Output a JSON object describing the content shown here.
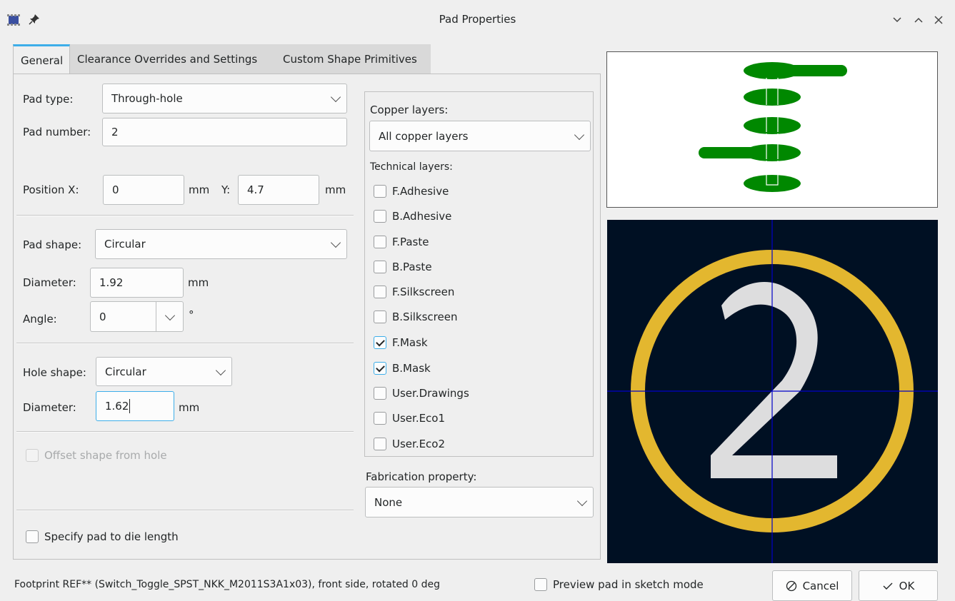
{
  "window": {
    "title": "Pad Properties",
    "icons": [
      "kicad-footprint-icon",
      "pin-icon"
    ],
    "controls": [
      "minimize-icon",
      "maximize-icon",
      "close-icon"
    ]
  },
  "tabs": [
    {
      "label": "General",
      "active": true
    },
    {
      "label": "Clearance Overrides and Settings",
      "active": false
    },
    {
      "label": "Custom Shape Primitives",
      "active": false
    }
  ],
  "general": {
    "pad_type_label": "Pad type:",
    "pad_type_value": "Through-hole",
    "pad_number_label": "Pad number:",
    "pad_number_value": "2",
    "position_x_label": "Position X:",
    "position_x_value": "0",
    "position_x_unit": "mm",
    "position_y_label": "Y:",
    "position_y_value": "4.7",
    "position_y_unit": "mm",
    "pad_shape_label": "Pad shape:",
    "pad_shape_value": "Circular",
    "diameter_label": "Diameter:",
    "diameter_value": "1.92",
    "diameter_unit": "mm",
    "angle_label": "Angle:",
    "angle_value": "0",
    "angle_unit": "°",
    "hole_shape_label": "Hole shape:",
    "hole_shape_value": "Circular",
    "hole_diameter_label": "Diameter:",
    "hole_diameter_value": "1.62",
    "hole_diameter_unit": "mm",
    "offset_shape_label": "Offset shape from hole",
    "pad_to_die_label": "Specify pad to die length"
  },
  "layers": {
    "copper_label": "Copper layers:",
    "copper_value": "All copper layers",
    "technical_label": "Technical layers:",
    "items": [
      {
        "label": "F.Adhesive",
        "checked": false
      },
      {
        "label": "B.Adhesive",
        "checked": false
      },
      {
        "label": "F.Paste",
        "checked": false
      },
      {
        "label": "B.Paste",
        "checked": false
      },
      {
        "label": "F.Silkscreen",
        "checked": false
      },
      {
        "label": "B.Silkscreen",
        "checked": false
      },
      {
        "label": "F.Mask",
        "checked": true
      },
      {
        "label": "B.Mask",
        "checked": true
      },
      {
        "label": "User.Drawings",
        "checked": false
      },
      {
        "label": "User.Eco1",
        "checked": false
      },
      {
        "label": "User.Eco2",
        "checked": false
      }
    ],
    "fabrication_label": "Fabrication property:",
    "fabrication_value": "None"
  },
  "preview": {
    "pad_number_glyph": "2",
    "copper_color": "#008800",
    "pad_ring_color": "#e3b72f",
    "number_color": "#e6e6e6",
    "background_color": "#001023",
    "crosshair_color": "#0000c8"
  },
  "footer": {
    "status_text": "Footprint REF** (Switch_Toggle_SPST_NKK_M2011S3A1x03), front side, rotated 0 deg",
    "sketch_mode_label": "Preview pad in sketch mode",
    "cancel_label": "Cancel",
    "ok_label": "OK"
  }
}
